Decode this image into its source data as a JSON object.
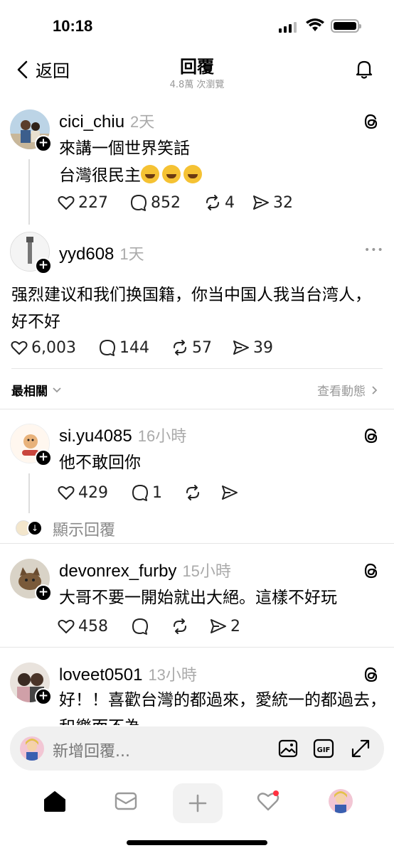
{
  "status": {
    "time": "10:18"
  },
  "header": {
    "back_label": "返回",
    "title": "回覆",
    "views": "4.8萬 次瀏覽"
  },
  "main_post": {
    "username": "cici_chiu",
    "time": "2天",
    "lines": [
      "來講一個世界笑話",
      "台灣很民主"
    ],
    "emoji_count": 3,
    "likes": "227",
    "comments": "852",
    "reposts": "4",
    "shares": "32"
  },
  "reply_top": {
    "username": "yyd608",
    "time": "1天",
    "more": "•••",
    "text": "强烈建议和我们换国籍，你当中国人我当台湾人，好不好",
    "likes": "6,003",
    "comments": "144",
    "reposts": "57",
    "shares": "39"
  },
  "sort": {
    "label": "最相關",
    "activity": "查看動態"
  },
  "replies": [
    {
      "username": "si.yu4085",
      "time": "16小時",
      "text": "他不敢回你",
      "likes": "429",
      "comments": "1",
      "reposts": "",
      "shares": "",
      "show_replies": "顯示回覆"
    },
    {
      "username": "devonrex_furby",
      "time": "15小時",
      "text": "大哥不要一開始就出大絕。這樣不好玩",
      "likes": "458",
      "comments": "",
      "reposts": "",
      "shares": "2"
    },
    {
      "username": "loveet0501",
      "time": "13小時",
      "text": "好！！喜歡台灣的都過來，愛統一的都過去，和樂而不為"
    }
  ],
  "compose": {
    "placeholder": "新增回覆..."
  },
  "colors": {
    "accent": "#000000",
    "muted": "#999999",
    "notify_dot": "#ff3040"
  }
}
